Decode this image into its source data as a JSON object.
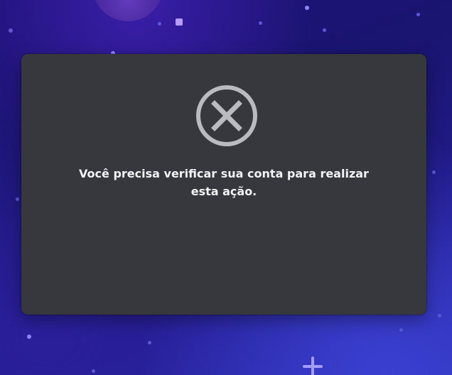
{
  "dialog": {
    "icon": "close-circle-icon",
    "message": "Você precisa verificar sua conta para realizar esta ação."
  },
  "colors": {
    "background": "#1e1278",
    "modal": "#37383d",
    "icon": "#b9bbbe",
    "text": "#f2f3f5"
  }
}
